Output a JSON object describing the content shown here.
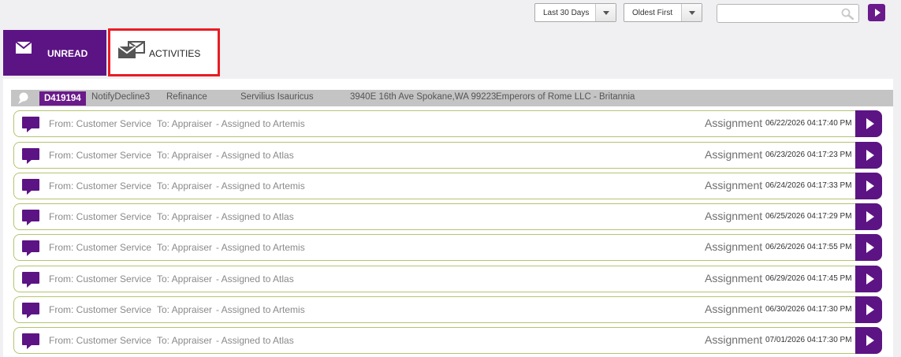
{
  "filters": {
    "date_range": "Last 30 Days",
    "sort_order": "Oldest First",
    "search_value": "",
    "search_placeholder": ""
  },
  "tabs": {
    "unread": "UNREAD",
    "activities": "ACTIVITIES"
  },
  "order": {
    "id": "D419194",
    "status": "NotifyDecline3",
    "loan_type": "Refinance",
    "borrower": "Servilius Isauricus",
    "address": "3940E 16th Ave Spokane,WA 99223",
    "client": "Emperors of Rome LLC - Britannia"
  },
  "activities": [
    {
      "from": "From: Customer Service",
      "to": "To: Appraiser",
      "note": "- Assigned to Artemis",
      "type": "Assignment",
      "date": "06/22/2026 04:17:40 PM"
    },
    {
      "from": "From: Customer Service",
      "to": "To: Appraiser",
      "note": "- Assigned to Atlas",
      "type": "Assignment",
      "date": "06/23/2026 04:17:23 PM"
    },
    {
      "from": "From: Customer Service",
      "to": "To: Appraiser",
      "note": "- Assigned to Artemis",
      "type": "Assignment",
      "date": "06/24/2026 04:17:33 PM"
    },
    {
      "from": "From: Customer Service",
      "to": "To: Appraiser",
      "note": "- Assigned to Atlas",
      "type": "Assignment",
      "date": "06/25/2026 04:17:29 PM"
    },
    {
      "from": "From: Customer Service",
      "to": "To: Appraiser",
      "note": "- Assigned to Artemis",
      "type": "Assignment",
      "date": "06/26/2026 04:17:55 PM"
    },
    {
      "from": "From: Customer Service",
      "to": "To: Appraiser",
      "note": "- Assigned to Atlas",
      "type": "Assignment",
      "date": "06/29/2026 04:17:45 PM"
    },
    {
      "from": "From: Customer Service",
      "to": "To: Appraiser",
      "note": "- Assigned to Artemis",
      "type": "Assignment",
      "date": "06/30/2026 04:17:30 PM"
    },
    {
      "from": "From: Customer Service",
      "to": "To: Appraiser",
      "note": "- Assigned to Atlas",
      "type": "Assignment",
      "date": "07/01/2026 04:17:30 PM"
    }
  ],
  "colors": {
    "accent_purple": "#5c1484",
    "highlight_red": "#e81c24",
    "row_border": "#b3c470"
  }
}
